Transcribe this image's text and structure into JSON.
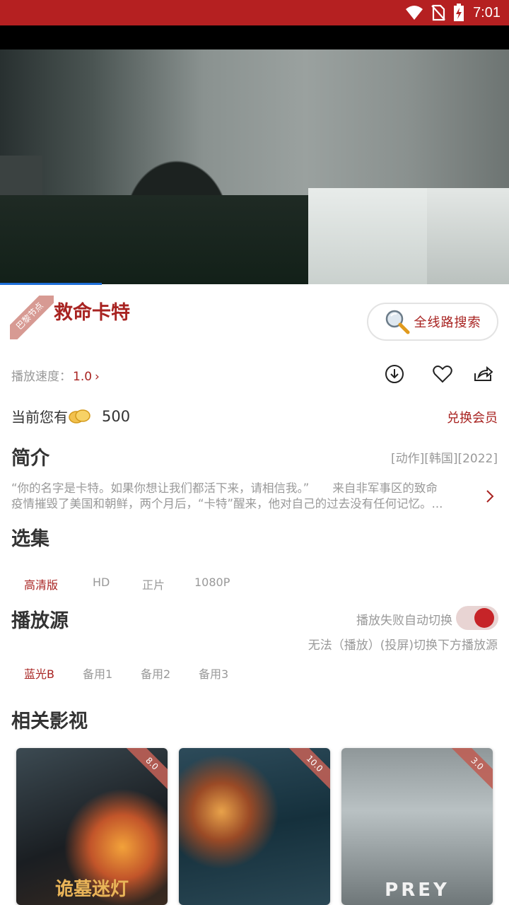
{
  "status_bar": {
    "time": "7:01"
  },
  "movie": {
    "title": "救命卡特",
    "ribbon": "巴黎节点",
    "search_label": "全线路搜索",
    "speed_label": "播放速度：",
    "speed_value": "1.0",
    "coins_label": "当前您有",
    "coins_value": "500",
    "redeem_label": "兑换会员"
  },
  "intro": {
    "heading": "简介",
    "tags": "[动作][韩国][2022]",
    "line1": "“你的名字是卡特。如果你想让我们都活下来，请相信我。”　　来自非军事区的致命",
    "line2": "疫情摧毁了美国和朝鲜，两个月后，“卡特”醒来，他对自己的过去没有任何记忆。..."
  },
  "episodes": {
    "heading": "选集",
    "items": [
      "高清版",
      "HD",
      "正片",
      "1080P"
    ]
  },
  "sources": {
    "heading": "播放源",
    "auto_switch_label": "播放失败自动切换",
    "auto_switch_on": true,
    "hint": "无法（播放）(投屏)切换下方播放源",
    "items": [
      "蓝光B",
      "备用1",
      "备用2",
      "备用3"
    ]
  },
  "related": {
    "heading": "相关影视",
    "cards": [
      {
        "rating": "8.0",
        "poster_title": "诡墓迷灯"
      },
      {
        "rating": "10.0",
        "poster_title": ""
      },
      {
        "rating": "3.0",
        "poster_title": "PREY"
      }
    ]
  },
  "colors": {
    "accent": "#a82321",
    "statusbar": "#b52021",
    "progress": "#1e6fd9"
  }
}
